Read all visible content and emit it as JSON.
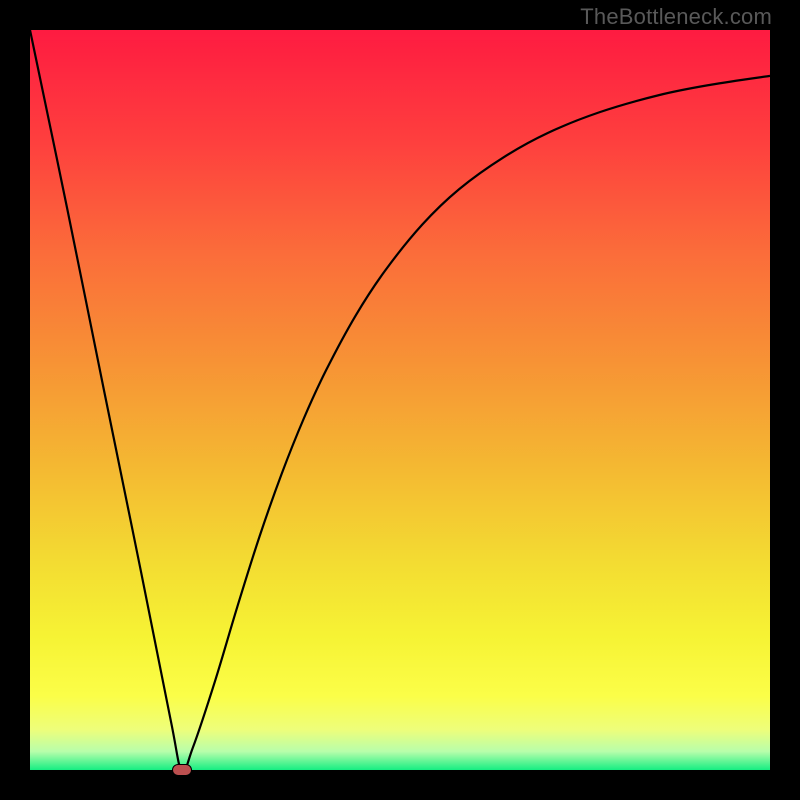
{
  "watermark": "TheBottleneck.com",
  "chart_data": {
    "type": "line",
    "title": "",
    "xlabel": "",
    "ylabel": "",
    "xlim": [
      0,
      1
    ],
    "ylim": [
      0,
      1
    ],
    "annotations": [
      {
        "name": "optimal-point-dot",
        "x": 0.205,
        "y": 0.0
      }
    ],
    "series": [
      {
        "name": "bottleneck-curve",
        "x": [
          0.0,
          0.05,
          0.1,
          0.15,
          0.19,
          0.205,
          0.22,
          0.25,
          0.28,
          0.31,
          0.34,
          0.37,
          0.4,
          0.44,
          0.48,
          0.53,
          0.58,
          0.64,
          0.7,
          0.77,
          0.85,
          0.92,
          1.0
        ],
        "y": [
          1.0,
          0.76,
          0.513,
          0.268,
          0.068,
          0.0,
          0.03,
          0.12,
          0.22,
          0.315,
          0.4,
          0.475,
          0.54,
          0.614,
          0.675,
          0.737,
          0.785,
          0.828,
          0.861,
          0.889,
          0.912,
          0.926,
          0.938
        ]
      }
    ],
    "background": {
      "type": "vertical-gradient",
      "stops": [
        {
          "offset": 0.0,
          "color": "#fe1b41"
        },
        {
          "offset": 0.15,
          "color": "#fe3f3e"
        },
        {
          "offset": 0.3,
          "color": "#fb6c3a"
        },
        {
          "offset": 0.45,
          "color": "#f79335"
        },
        {
          "offset": 0.6,
          "color": "#f4bb32"
        },
        {
          "offset": 0.72,
          "color": "#f3dc32"
        },
        {
          "offset": 0.82,
          "color": "#f6f334"
        },
        {
          "offset": 0.9,
          "color": "#fbfe48"
        },
        {
          "offset": 0.945,
          "color": "#eefe7a"
        },
        {
          "offset": 0.975,
          "color": "#b8feab"
        },
        {
          "offset": 1.0,
          "color": "#16ee82"
        }
      ]
    }
  }
}
